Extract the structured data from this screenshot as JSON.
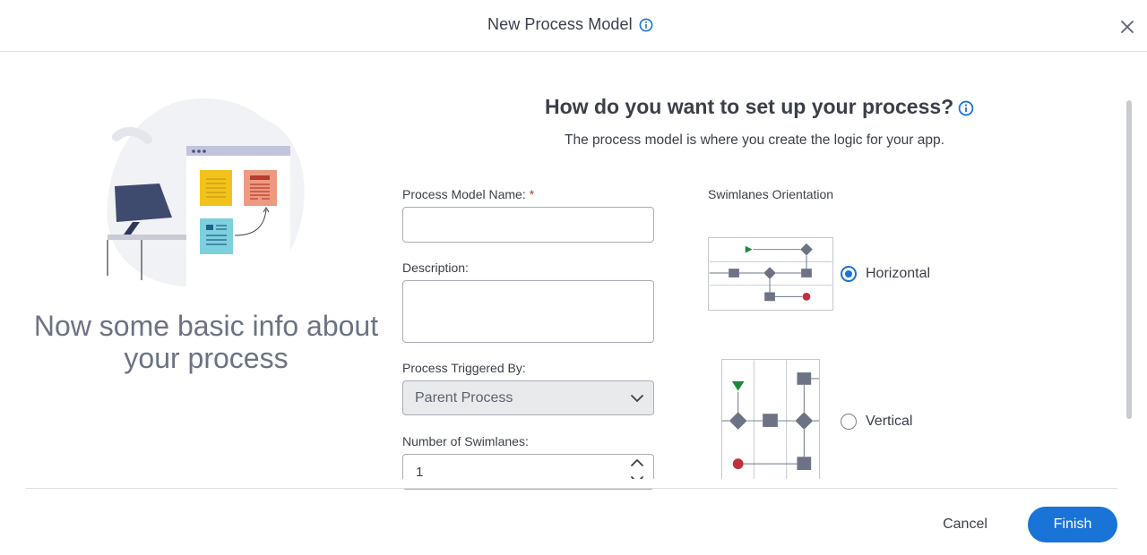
{
  "header": {
    "title": "New Process Model",
    "icons": {
      "info": "info-circle-icon",
      "close": "close-icon"
    }
  },
  "left": {
    "heading": "Now some basic info about your process",
    "illustration": "sticky-notes-board-illustration"
  },
  "section": {
    "title": "How do you want to set up your process?",
    "subtitle": "The process model is where you create the logic for your app."
  },
  "form": {
    "name_label": "Process Model Name:",
    "required_marker": "*",
    "name_value": "",
    "description_label": "Description:",
    "description_value": "",
    "triggered_label": "Process Triggered By:",
    "triggered_value": "Parent Process",
    "swimlanes_label": "Number of Swimlanes:",
    "swimlanes_value": "1"
  },
  "orientation": {
    "label": "Swimlanes Orientation",
    "options": [
      {
        "label": "Horizontal",
        "selected": true
      },
      {
        "label": "Vertical",
        "selected": false
      }
    ]
  },
  "footer": {
    "cancel_label": "Cancel",
    "finish_label": "Finish"
  },
  "colors": {
    "accent": "#1a73d6",
    "required": "#d0302f",
    "start_node": "#1a8a3a",
    "end_node": "#c0303a",
    "node": "#6b7384"
  }
}
